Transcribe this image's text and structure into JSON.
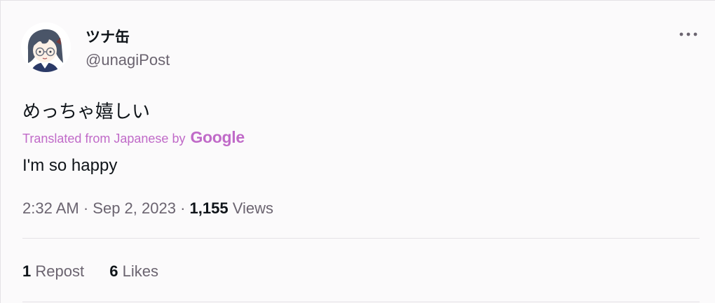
{
  "user": {
    "display_name": "ツナ缶",
    "handle": "@unagiPost",
    "avatar_icon": "anime-avatar-icon"
  },
  "more_icon": "more-dots-icon",
  "tweet": {
    "text": "めっちゃ嬉しい",
    "translated_label": "Translated from Japanese by",
    "translator": "Google",
    "translation": "I'm so happy"
  },
  "meta": {
    "time": "2:32 AM",
    "sep1": "·",
    "date": "Sep 2, 2023",
    "sep2": "·",
    "views_count": "1,155",
    "views_label": "Views"
  },
  "stats": {
    "reposts_count": "1",
    "reposts_label": "Repost",
    "likes_count": "6",
    "likes_label": "Likes"
  },
  "colors": {
    "translated": "#c06ac8",
    "secondary": "#6b6470",
    "primary": "#0f1419"
  }
}
